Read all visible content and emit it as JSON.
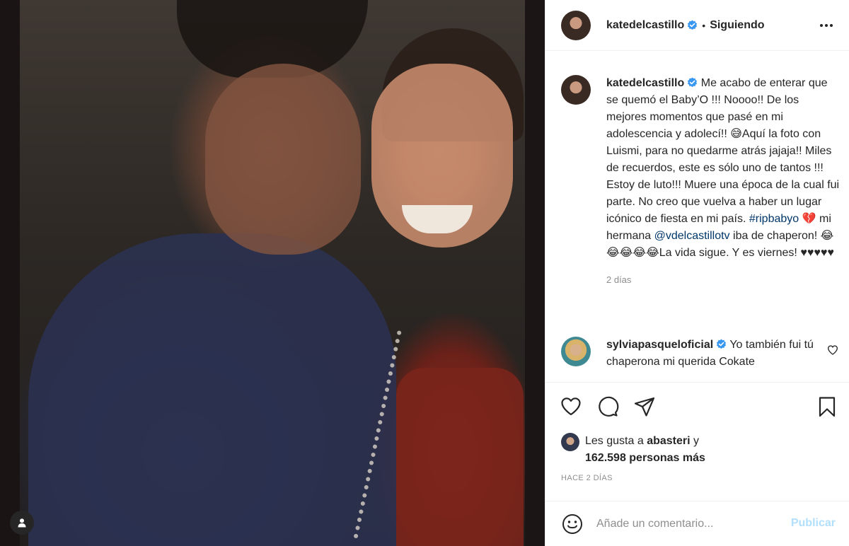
{
  "post": {
    "author": "katedelcastillo",
    "follow_status": "Siguiendo",
    "separator": "•"
  },
  "caption": {
    "username": "katedelcastillo",
    "text_before_hashtag": "Me acabo de enterar que se quemó el Baby’O !!! Noooo!! De los mejores momentos que pasé en mi adolescencia y adolecí!! 😅Aquí la foto con Luismi, para no quedarme atrás jajaja!! Miles de recuerdos, este es sólo uno de tantos !!! Estoy de luto!!! Muere una época de la cual fui parte. No creo que vuelva a haber un lugar icónico de fiesta en mi país.",
    "hashtag": "#ripbabyo",
    "broken_heart": "💔",
    "text_middle": "mi hermana",
    "mention": "@vdelcastillotv",
    "text_after_mention": "iba de chaperon! 😂😂😂😂😂La vida sigue. Y es viernes! ♥♥♥♥♥",
    "time": "2 días"
  },
  "comment": {
    "username": "sylviapasqueloficial",
    "text": "Yo también fui tú chaperona mi querida Cokate"
  },
  "likes": {
    "prefix": "Les gusta a",
    "user": "abasteri",
    "joiner": "y",
    "count_text": "162.598 personas más"
  },
  "date": "HACE 2 DÍAS",
  "add_comment": {
    "placeholder": "Añade un comentario...",
    "publish_label": "Publicar"
  },
  "icons": {
    "header": [
      "verified-badge-icon",
      "more-options-icon"
    ],
    "actions": [
      "heart-icon",
      "comment-icon",
      "share-icon",
      "bookmark-icon"
    ],
    "comment_input": [
      "emoji-icon"
    ],
    "photo": [
      "user-tag-icon"
    ]
  },
  "colors": {
    "verified": "#3897f0",
    "link": "#00376b",
    "publish_disabled": "#b2dffc",
    "muted": "#8e8e8e"
  }
}
